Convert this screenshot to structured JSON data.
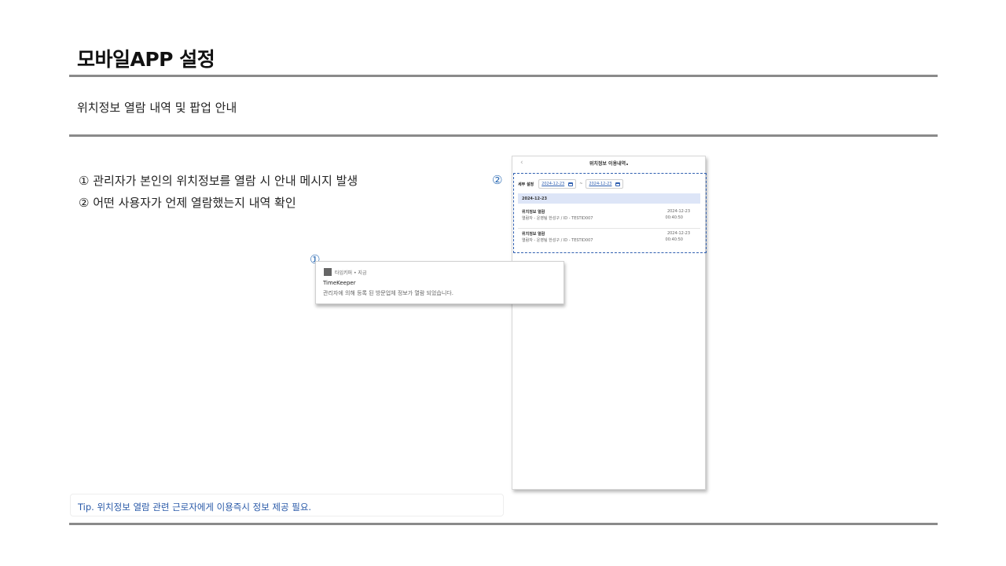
{
  "page": {
    "title": "모바일APP 설정",
    "subtitle": "위치정보 열람 내역 및 팝업 안내",
    "descriptions": [
      "① 관리자가 본인의 위치정보를 열람 시 안내 메시지 발생",
      "② 어떤 사용자가 언제 열람했는지 내역 확인"
    ],
    "markers": {
      "one": "①",
      "two": "②"
    },
    "tip": "Tip. 위치정보 열람 관련 근로자에게 이용즉시 정보 제공 필요."
  },
  "phone": {
    "back_icon": "‹",
    "title": "위치정보 이용내역",
    "filter_label": "세부 설정",
    "date_from": "2024-12-23",
    "date_to": "2024-12-23",
    "separator": "~",
    "date_group": "2024-12-23",
    "rows": [
      {
        "title": "위치정보 열람",
        "subtitle": "열람자 - 운영팀 한성구 / ID - TESTID007",
        "date": "2024-12-23",
        "time": "00:40:50"
      },
      {
        "title": "위치정보 열람",
        "subtitle": "열람자 - 운영팀 한성구 / ID - TESTID007",
        "date": "2024-12-23",
        "time": "00:40:50"
      }
    ]
  },
  "notification": {
    "app_meta": "타임키퍼 • 지금",
    "title": "TimeKeeper",
    "message": "관리자에 의해 등록 된 방문업체 정보가 열람 되었습니다."
  },
  "colors": {
    "accent": "#2f6db5",
    "rule": "#8a8a8a",
    "highlight_bg": "#dde5f7"
  }
}
